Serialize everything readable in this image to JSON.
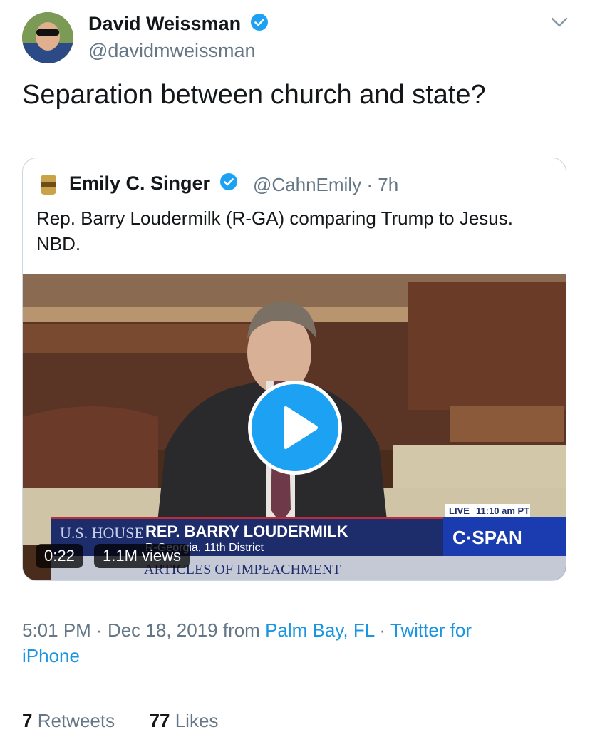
{
  "author": {
    "name": "David Weissman",
    "handle": "@davidmweissman",
    "verified": true
  },
  "tweet": {
    "text": "Separation between church and state?"
  },
  "quoted": {
    "name": "Emily C. Singer",
    "handle": "@CahnEmily",
    "time": "7h",
    "separator": "·",
    "text": "Rep. Barry Loudermilk (R-GA) comparing Trump to Jesus. NBD.",
    "video": {
      "duration": "0:22",
      "views": "1.1M views",
      "chyron": {
        "live_label": "LIVE",
        "time": "11:10 am PT",
        "network": "C·SPAN",
        "house_label": "U.S. HOUSE",
        "speaker": "REP. BARRY LOUDERMILK",
        "subtitle": "R-Georgia, 11th District",
        "topic": "ARTICLES OF IMPEACHMENT"
      }
    }
  },
  "meta": {
    "time": "5:01 PM",
    "date": "Dec 18, 2019",
    "from_label": "from",
    "location": "Palm Bay, FL",
    "source_line1": "Twitter for",
    "source_line2": "iPhone"
  },
  "stats": {
    "retweets_count": "7",
    "retweets_label": "Retweets",
    "likes_count": "77",
    "likes_label": "Likes"
  },
  "colors": {
    "link": "#1b95e0",
    "verified": "#1da1f2",
    "secondary_text": "#657786",
    "border": "#ccd6dd"
  },
  "icons": [
    "verified-badge-icon",
    "chevron-down-icon",
    "play-icon"
  ]
}
